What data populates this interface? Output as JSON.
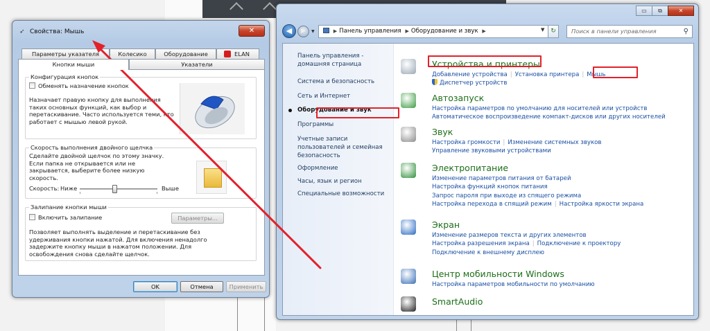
{
  "dialog": {
    "title": "Свойства: Мышь",
    "close_glyph": "✕",
    "tabs_row1": [
      "Параметры указателя",
      "Колесико",
      "Оборудование",
      "ELAN"
    ],
    "tabs_row2": [
      "Кнопки мыши",
      "Указатели"
    ],
    "buttons_config": {
      "label": "Конфигурация кнопок",
      "checkbox": "Обменять назначение кнопок",
      "text": "Назначает правую кнопку для выполнения таких основных функций, как выбор и перетаскивание. Часто используется теми, кто работает с мышью левой рукой."
    },
    "double_click": {
      "label": "Скорость выполнения двойного щелчка",
      "text": "Сделайте двойной щелчок по этому значку. Если папка не открывается или не закрывается, выберите более низкую скорость.",
      "speed_label": "Скорость:",
      "low": "Ниже",
      "high": "Выше",
      "speed_level": 0.45
    },
    "click_lock": {
      "label": "Залипание кнопки мыши",
      "checkbox": "Включить залипание",
      "params_button": "Параметры...",
      "text": "Позволяет выполнять выделение и перетаскивание без удерживания кнопки нажатой. Для включения ненадолго задержите кнопку мыши в нажатом положении. Для освобождения снова сделайте щелчок."
    },
    "ok": "OK",
    "cancel": "Отмена",
    "apply": "Применить"
  },
  "window": {
    "min_glyph": "▭",
    "max_glyph": "⧉",
    "close_glyph": "✕",
    "address": [
      "Панель управления",
      "Оборудование и звук"
    ],
    "search_placeholder": "Поиск в панели управления",
    "left_pane": [
      "Панель управления -",
      "домашняя страница",
      "Система и безопасность",
      "Сеть и Интернет",
      "Оборудование и звук",
      "Программы",
      "Учетные записи",
      "пользователей и семейная",
      "безопасность",
      "Оформление",
      "Часы, язык и регион",
      "Специальные возможности"
    ],
    "categories": [
      {
        "title": "Устройства и принтеры",
        "icon": "printer-icon",
        "color": "#9aa7b5",
        "links": [
          [
            "Добавление устройства",
            "Установка принтера",
            "Мышь"
          ],
          [
            "Диспетчер устройств"
          ]
        ]
      },
      {
        "title": "Автозапуск",
        "icon": "autoplay-icon",
        "color": "#3d9b43",
        "links": [
          [
            "Настройка параметров по умолчанию для носителей или устройств"
          ],
          [
            "Автоматическое воспроизведение компакт-дисков или других носителей"
          ]
        ]
      },
      {
        "title": "Звук",
        "icon": "speaker-icon",
        "color": "#8c8c8c",
        "links": [
          [
            "Настройка громкости",
            "Изменение системных звуков"
          ],
          [
            "Управление звуковыми устройствами"
          ]
        ]
      },
      {
        "title": "Электропитание",
        "icon": "battery-icon",
        "color": "#2f8f3a",
        "links": [
          [
            "Изменение параметров питания от батарей"
          ],
          [
            "Настройка функций кнопок питания"
          ],
          [
            "Запрос пароля при выходе из спящего режима"
          ],
          [
            "Настройка перехода в спящий режим",
            "Настройка яркости экрана"
          ]
        ]
      },
      {
        "title": "Экран",
        "icon": "monitor-icon",
        "color": "#2b6cc4",
        "links": [
          [
            "Изменение размеров текста и других элементов"
          ],
          [
            "Настройка разрешения экрана",
            "Подключение к проектору"
          ],
          [
            "Подключение к внешнему дисплею"
          ]
        ]
      },
      {
        "title": "Центр мобильности Windows",
        "icon": "laptop-icon",
        "color": "#3a6fb7",
        "links": [
          [
            "Настройка параметров мобильности по умолчанию"
          ]
        ]
      },
      {
        "title": "SmartAudio",
        "icon": "headphones-icon",
        "color": "#222222",
        "links": []
      }
    ]
  },
  "highlight_color": "#e2212b"
}
